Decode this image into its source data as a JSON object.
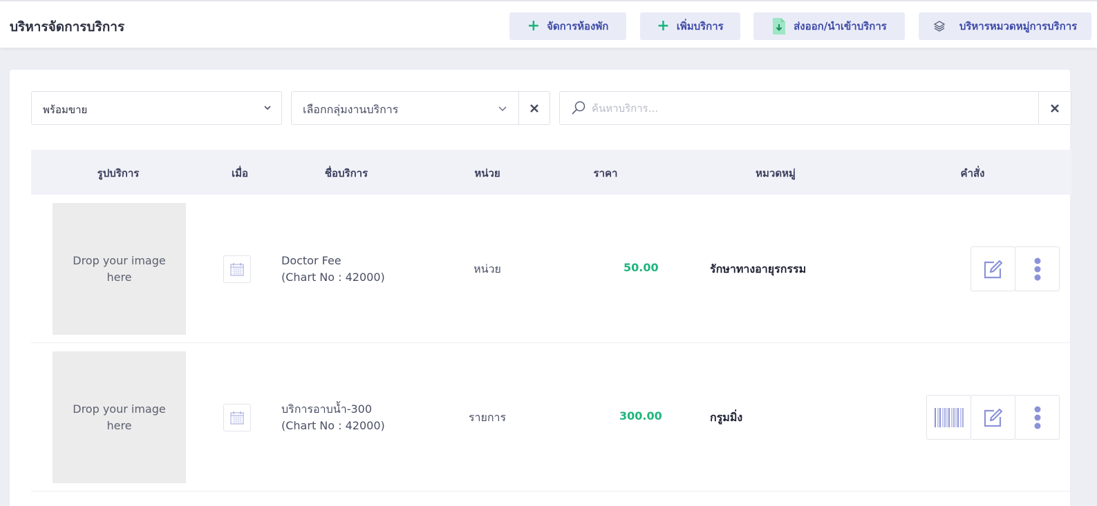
{
  "header": {
    "title": "บริหารจัดการบริการ",
    "buttons": [
      {
        "label": "จัดการห้องพัก",
        "icon": "plus-icon"
      },
      {
        "label": "เพิ่มบริการ",
        "icon": "plus-icon"
      },
      {
        "label": "ส่งออก/นำเข้าบริการ",
        "icon": "file-download-icon"
      },
      {
        "label": "บริหารหมวดหมู่การบริการ",
        "icon": "layers-icon"
      }
    ]
  },
  "filters": {
    "status_value": "พร้อมขาย",
    "group_value": "เลือกกลุ่มงานบริการ",
    "search_placeholder": "ค้นหาบริการ..."
  },
  "table": {
    "columns": [
      "รูปบริการ",
      "เมื่อ",
      "ชื่อบริการ",
      "หน่วย",
      "ราคา",
      "หมวดหมู่",
      "คำสั่ง"
    ],
    "rows": [
      {
        "image_text": "Drop your image here",
        "name": "Doctor Fee",
        "chart": "(Chart No : 42000)",
        "unit": "หน่วย",
        "price": "50.00",
        "category": "รักษาทางอายุรกรรม",
        "has_barcode": false
      },
      {
        "image_text": "Drop your image here",
        "name": "บริการอาบน้ำ-300",
        "chart": "(Chart No : 42000)",
        "unit": "รายการ",
        "price": "300.00",
        "category": "กรูมมิ่ง",
        "has_barcode": true
      }
    ]
  },
  "colors": {
    "accent": "#3f4aa8",
    "price_green": "#1fb57e",
    "button_bg": "#e9ecf7",
    "icon_purple": "#8b93d8"
  }
}
